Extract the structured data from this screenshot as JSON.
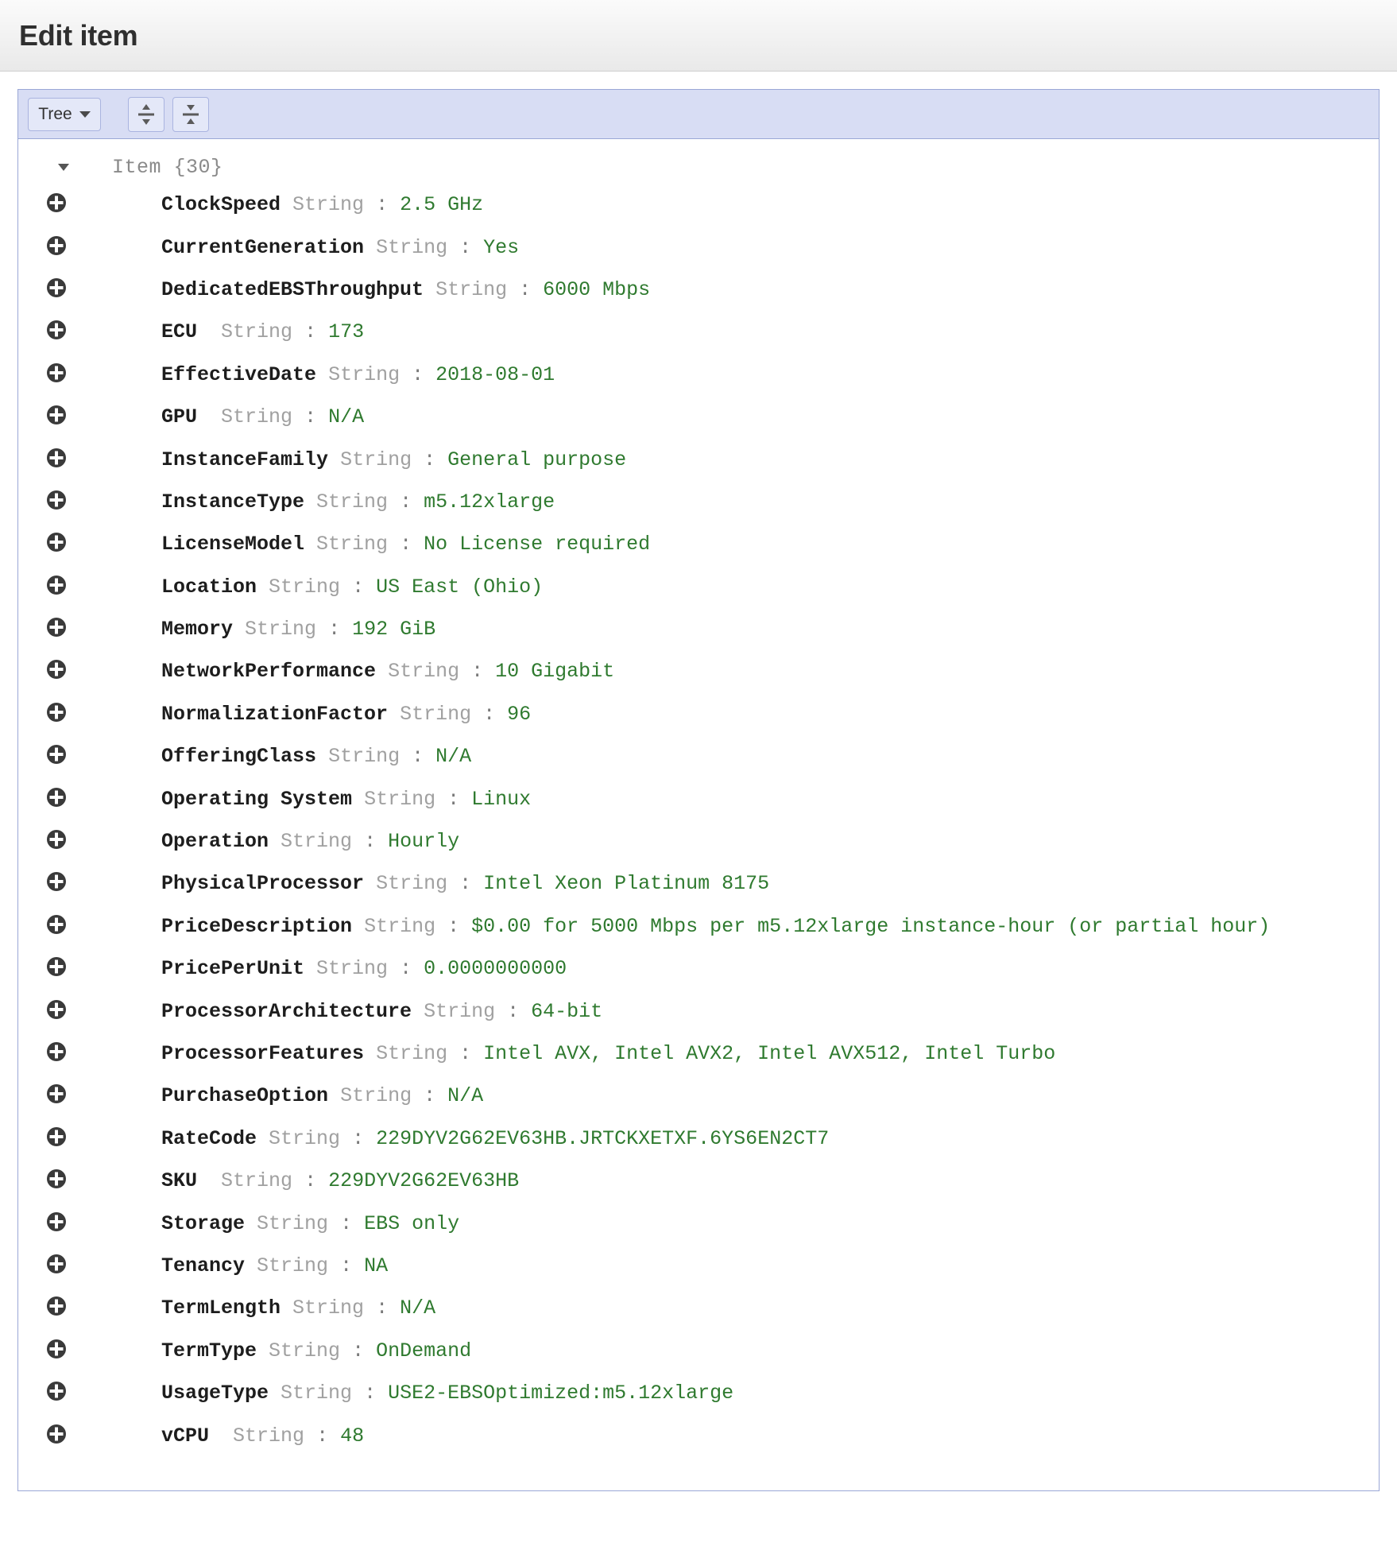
{
  "header": {
    "title": "Edit item"
  },
  "toolbar": {
    "mode_label": "Tree",
    "expand_all_title": "Expand all",
    "collapse_all_title": "Collapse all"
  },
  "tree": {
    "root_label": "Item {30}",
    "type_label": "String",
    "colon": ":",
    "rows": [
      {
        "key": "ClockSpeed",
        "type": "String",
        "value": "2.5 GHz"
      },
      {
        "key": "CurrentGeneration",
        "type": "String",
        "value": "Yes"
      },
      {
        "key": "DedicatedEBSThroughput",
        "type": "String",
        "value": "6000 Mbps"
      },
      {
        "key": "ECU ",
        "type": "String",
        "value": "173"
      },
      {
        "key": "EffectiveDate",
        "type": "String",
        "value": "2018-08-01"
      },
      {
        "key": "GPU ",
        "type": "String",
        "value": "N/A"
      },
      {
        "key": "InstanceFamily",
        "type": "String",
        "value": "General purpose"
      },
      {
        "key": "InstanceType",
        "type": "String",
        "value": "m5.12xlarge"
      },
      {
        "key": "LicenseModel",
        "type": "String",
        "value": "No License required"
      },
      {
        "key": "Location",
        "type": "String",
        "value": "US East (Ohio)"
      },
      {
        "key": "Memory",
        "type": "String",
        "value": "192 GiB"
      },
      {
        "key": "NetworkPerformance",
        "type": "String",
        "value": "10 Gigabit"
      },
      {
        "key": "NormalizationFactor",
        "type": "String",
        "value": "96"
      },
      {
        "key": "OfferingClass",
        "type": "String",
        "value": "N/A"
      },
      {
        "key": "Operating System",
        "type": "String",
        "value": "Linux"
      },
      {
        "key": "Operation",
        "type": "String",
        "value": "Hourly"
      },
      {
        "key": "PhysicalProcessor",
        "type": "String",
        "value": "Intel Xeon Platinum 8175"
      },
      {
        "key": "PriceDescription",
        "type": "String",
        "value": "$0.00 for 5000 Mbps per m5.12xlarge instance-hour (or partial hour)"
      },
      {
        "key": "PricePerUnit",
        "type": "String",
        "value": "0.0000000000"
      },
      {
        "key": "ProcessorArchitecture",
        "type": "String",
        "value": "64-bit"
      },
      {
        "key": "ProcessorFeatures",
        "type": "String",
        "value": "Intel AVX, Intel AVX2, Intel AVX512, Intel Turbo"
      },
      {
        "key": "PurchaseOption",
        "type": "String",
        "value": "N/A"
      },
      {
        "key": "RateCode",
        "type": "String",
        "value": "229DYV2G62EV63HB.JRTCKXETXF.6YS6EN2CT7"
      },
      {
        "key": "SKU ",
        "type": "String",
        "value": "229DYV2G62EV63HB"
      },
      {
        "key": "Storage",
        "type": "String",
        "value": "EBS only"
      },
      {
        "key": "Tenancy",
        "type": "String",
        "value": "NA"
      },
      {
        "key": "TermLength",
        "type": "String",
        "value": "N/A"
      },
      {
        "key": "TermType",
        "type": "String",
        "value": "OnDemand"
      },
      {
        "key": "UsageType",
        "type": "String",
        "value": "USE2-EBSOptimized:m5.12xlarge"
      },
      {
        "key": "vCPU ",
        "type": "String",
        "value": "48"
      }
    ]
  },
  "colors": {
    "value_green": "#2f7a2f",
    "type_gray": "#a0a0a0",
    "toolbar_lavender": "#d8ddf4",
    "border_blue": "#9aa7d6"
  }
}
